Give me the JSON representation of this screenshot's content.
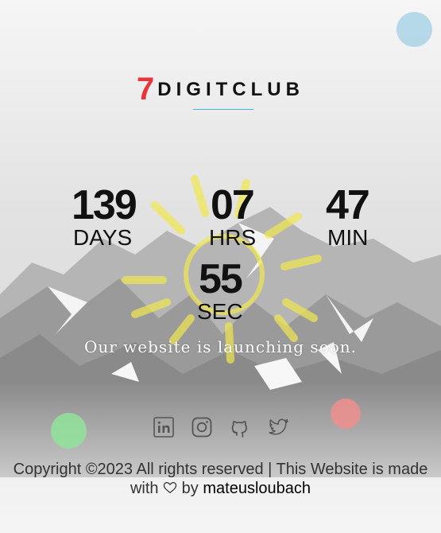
{
  "brand": {
    "number": "7",
    "name": "DIGITCLUB",
    "number_color": "#e8343a",
    "accent_line_color": "#40bcd8"
  },
  "countdown": {
    "days": {
      "value": "139",
      "label": "DAYS"
    },
    "hours": {
      "value": "07",
      "label": "HRS"
    },
    "minutes": {
      "value": "47",
      "label": "MIN"
    },
    "seconds": {
      "value": "55",
      "label": "SEC"
    }
  },
  "tagline": "Our website is launching soon.",
  "social": [
    {
      "name": "linkedin",
      "icon": "linkedin-icon"
    },
    {
      "name": "instagram",
      "icon": "instagram-icon"
    },
    {
      "name": "github",
      "icon": "github-icon"
    },
    {
      "name": "twitter",
      "icon": "twitter-icon"
    }
  ],
  "footer": {
    "line1": "Copyright ©2023 All rights reserved | This Website is made",
    "with": "with",
    "by": "by",
    "author": "mateusloubach",
    "heart_icon": "heart-icon"
  },
  "colors": {
    "bubble_blue": "#a9d3e6",
    "bubble_green": "#92e39b",
    "bubble_red": "#f08e8f",
    "sun": "#f1e94f"
  }
}
